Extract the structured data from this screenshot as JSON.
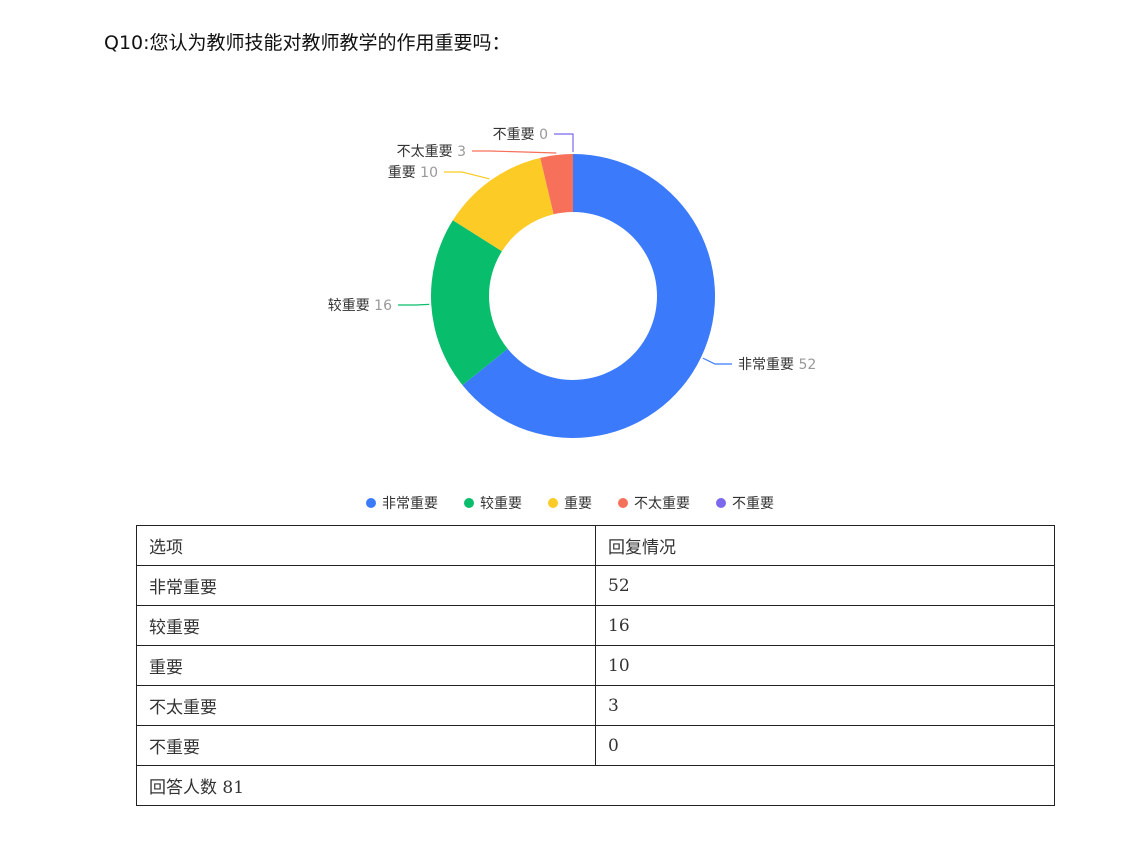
{
  "question": "Q10:您认为教师技能对教师教学的作用重要吗：",
  "chart_data": {
    "type": "pie",
    "subtype": "donut",
    "categories": [
      "非常重要",
      "较重要",
      "重要",
      "不太重要",
      "不重要"
    ],
    "values": [
      52,
      16,
      10,
      3,
      0
    ],
    "colors": [
      "#3b7bfb",
      "#08bd6b",
      "#fccb26",
      "#f6705a",
      "#7b68ee"
    ],
    "legend_position": "bottom"
  },
  "table": {
    "headers": [
      "选项",
      "回复情况"
    ],
    "rows": [
      [
        "非常重要",
        "52"
      ],
      [
        "较重要",
        "16"
      ],
      [
        "重要",
        "10"
      ],
      [
        "不太重要",
        "3"
      ],
      [
        "不重要",
        "0"
      ]
    ],
    "footer": "回答人数 81"
  }
}
